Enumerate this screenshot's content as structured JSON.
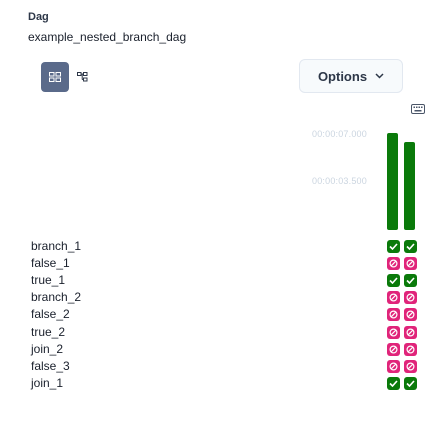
{
  "header": {
    "label": "Dag",
    "dag_id": "example_nested_branch_dag"
  },
  "view_toggle": {
    "active": "grid",
    "items": [
      "grid-view-icon",
      "graph-view-icon"
    ]
  },
  "options_button": {
    "label": "Options",
    "icon": "chevron-down-icon"
  },
  "shortcuts_icon": "keyboard-icon",
  "duration_axis": {
    "max_label": "00:00:07.000",
    "mid_label": "00:00:03.500"
  },
  "runs": [
    {
      "duration_fraction": 1.0,
      "state": "success",
      "color": "#0a7a0a"
    },
    {
      "duration_fraction": 0.91,
      "state": "success",
      "color": "#0a7a0a"
    }
  ],
  "state_colors": {
    "success": "#0a7a0a",
    "skipped": "#e0247a"
  },
  "tasks": [
    {
      "name": "branch_1",
      "states": [
        "success",
        "success"
      ]
    },
    {
      "name": "false_1",
      "states": [
        "skipped",
        "skipped"
      ]
    },
    {
      "name": "true_1",
      "states": [
        "success",
        "success"
      ]
    },
    {
      "name": "branch_2",
      "states": [
        "skipped",
        "skipped"
      ]
    },
    {
      "name": "false_2",
      "states": [
        "skipped",
        "skipped"
      ]
    },
    {
      "name": "true_2",
      "states": [
        "skipped",
        "skipped"
      ]
    },
    {
      "name": "join_2",
      "states": [
        "skipped",
        "skipped"
      ]
    },
    {
      "name": "false_3",
      "states": [
        "skipped",
        "skipped"
      ]
    },
    {
      "name": "join_1",
      "states": [
        "success",
        "success"
      ]
    }
  ]
}
